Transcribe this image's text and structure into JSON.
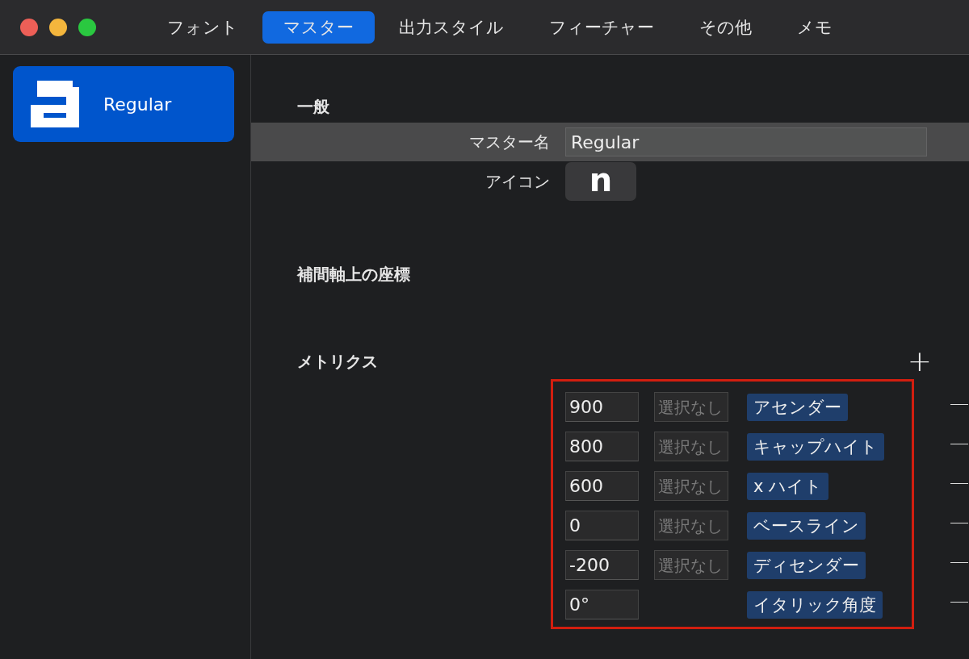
{
  "tabs": [
    {
      "label": "フォント",
      "selected": false
    },
    {
      "label": "マスター",
      "selected": true
    },
    {
      "label": "出力スタイル",
      "selected": false
    },
    {
      "label": "フィーチャー",
      "selected": false
    },
    {
      "label": "その他",
      "selected": false
    },
    {
      "label": "メモ",
      "selected": false
    }
  ],
  "sidebar": {
    "items": [
      {
        "label": "Regular",
        "selected": true
      }
    ]
  },
  "general": {
    "title": "一般",
    "master_name": {
      "label": "マスター名",
      "value": "Regular"
    },
    "icon": {
      "label": "アイコン",
      "glyph": "n"
    }
  },
  "axes": {
    "title": "補間軸上の座標"
  },
  "metrics": {
    "title": "メトリクス",
    "add_button": "+",
    "rows": [
      {
        "value": "900",
        "placeholder": "選択なし",
        "tag": "アセンダー"
      },
      {
        "value": "800",
        "placeholder": "選択なし",
        "tag": "キャップハイト"
      },
      {
        "value": "600",
        "placeholder": "選択なし",
        "tag": "x ハイト"
      },
      {
        "value": "0",
        "placeholder": "選択なし",
        "tag": "ベースライン"
      },
      {
        "value": "-200",
        "placeholder": "選択なし",
        "tag": "ディセンダー"
      },
      {
        "value": "0°",
        "tag": "イタリック角度"
      }
    ]
  }
}
